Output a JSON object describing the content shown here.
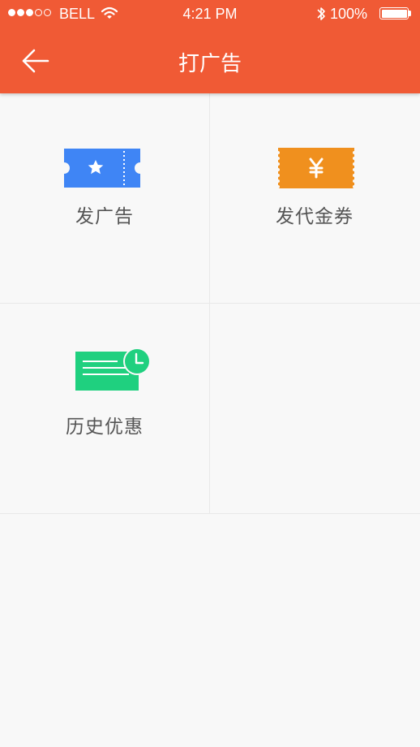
{
  "status_bar": {
    "carrier": "BELL",
    "time": "4:21 PM",
    "battery": "100%",
    "signal_bars_filled": 3,
    "signal_bars_total": 5
  },
  "nav": {
    "title": "打广告",
    "back_icon": "arrow-left-icon"
  },
  "grid": {
    "items": [
      {
        "label": "发广告",
        "icon": "ticket-star-icon",
        "color": "#3f85f5"
      },
      {
        "label": "发代金券",
        "icon": "coupon-yen-icon",
        "color": "#f0901e"
      },
      {
        "label": "历史优惠",
        "icon": "history-message-icon",
        "color": "#1fd07f"
      }
    ]
  },
  "colors": {
    "header": "#f05a35",
    "background": "#f8f8f8",
    "label": "#555555",
    "divider": "#e8e8e8"
  }
}
